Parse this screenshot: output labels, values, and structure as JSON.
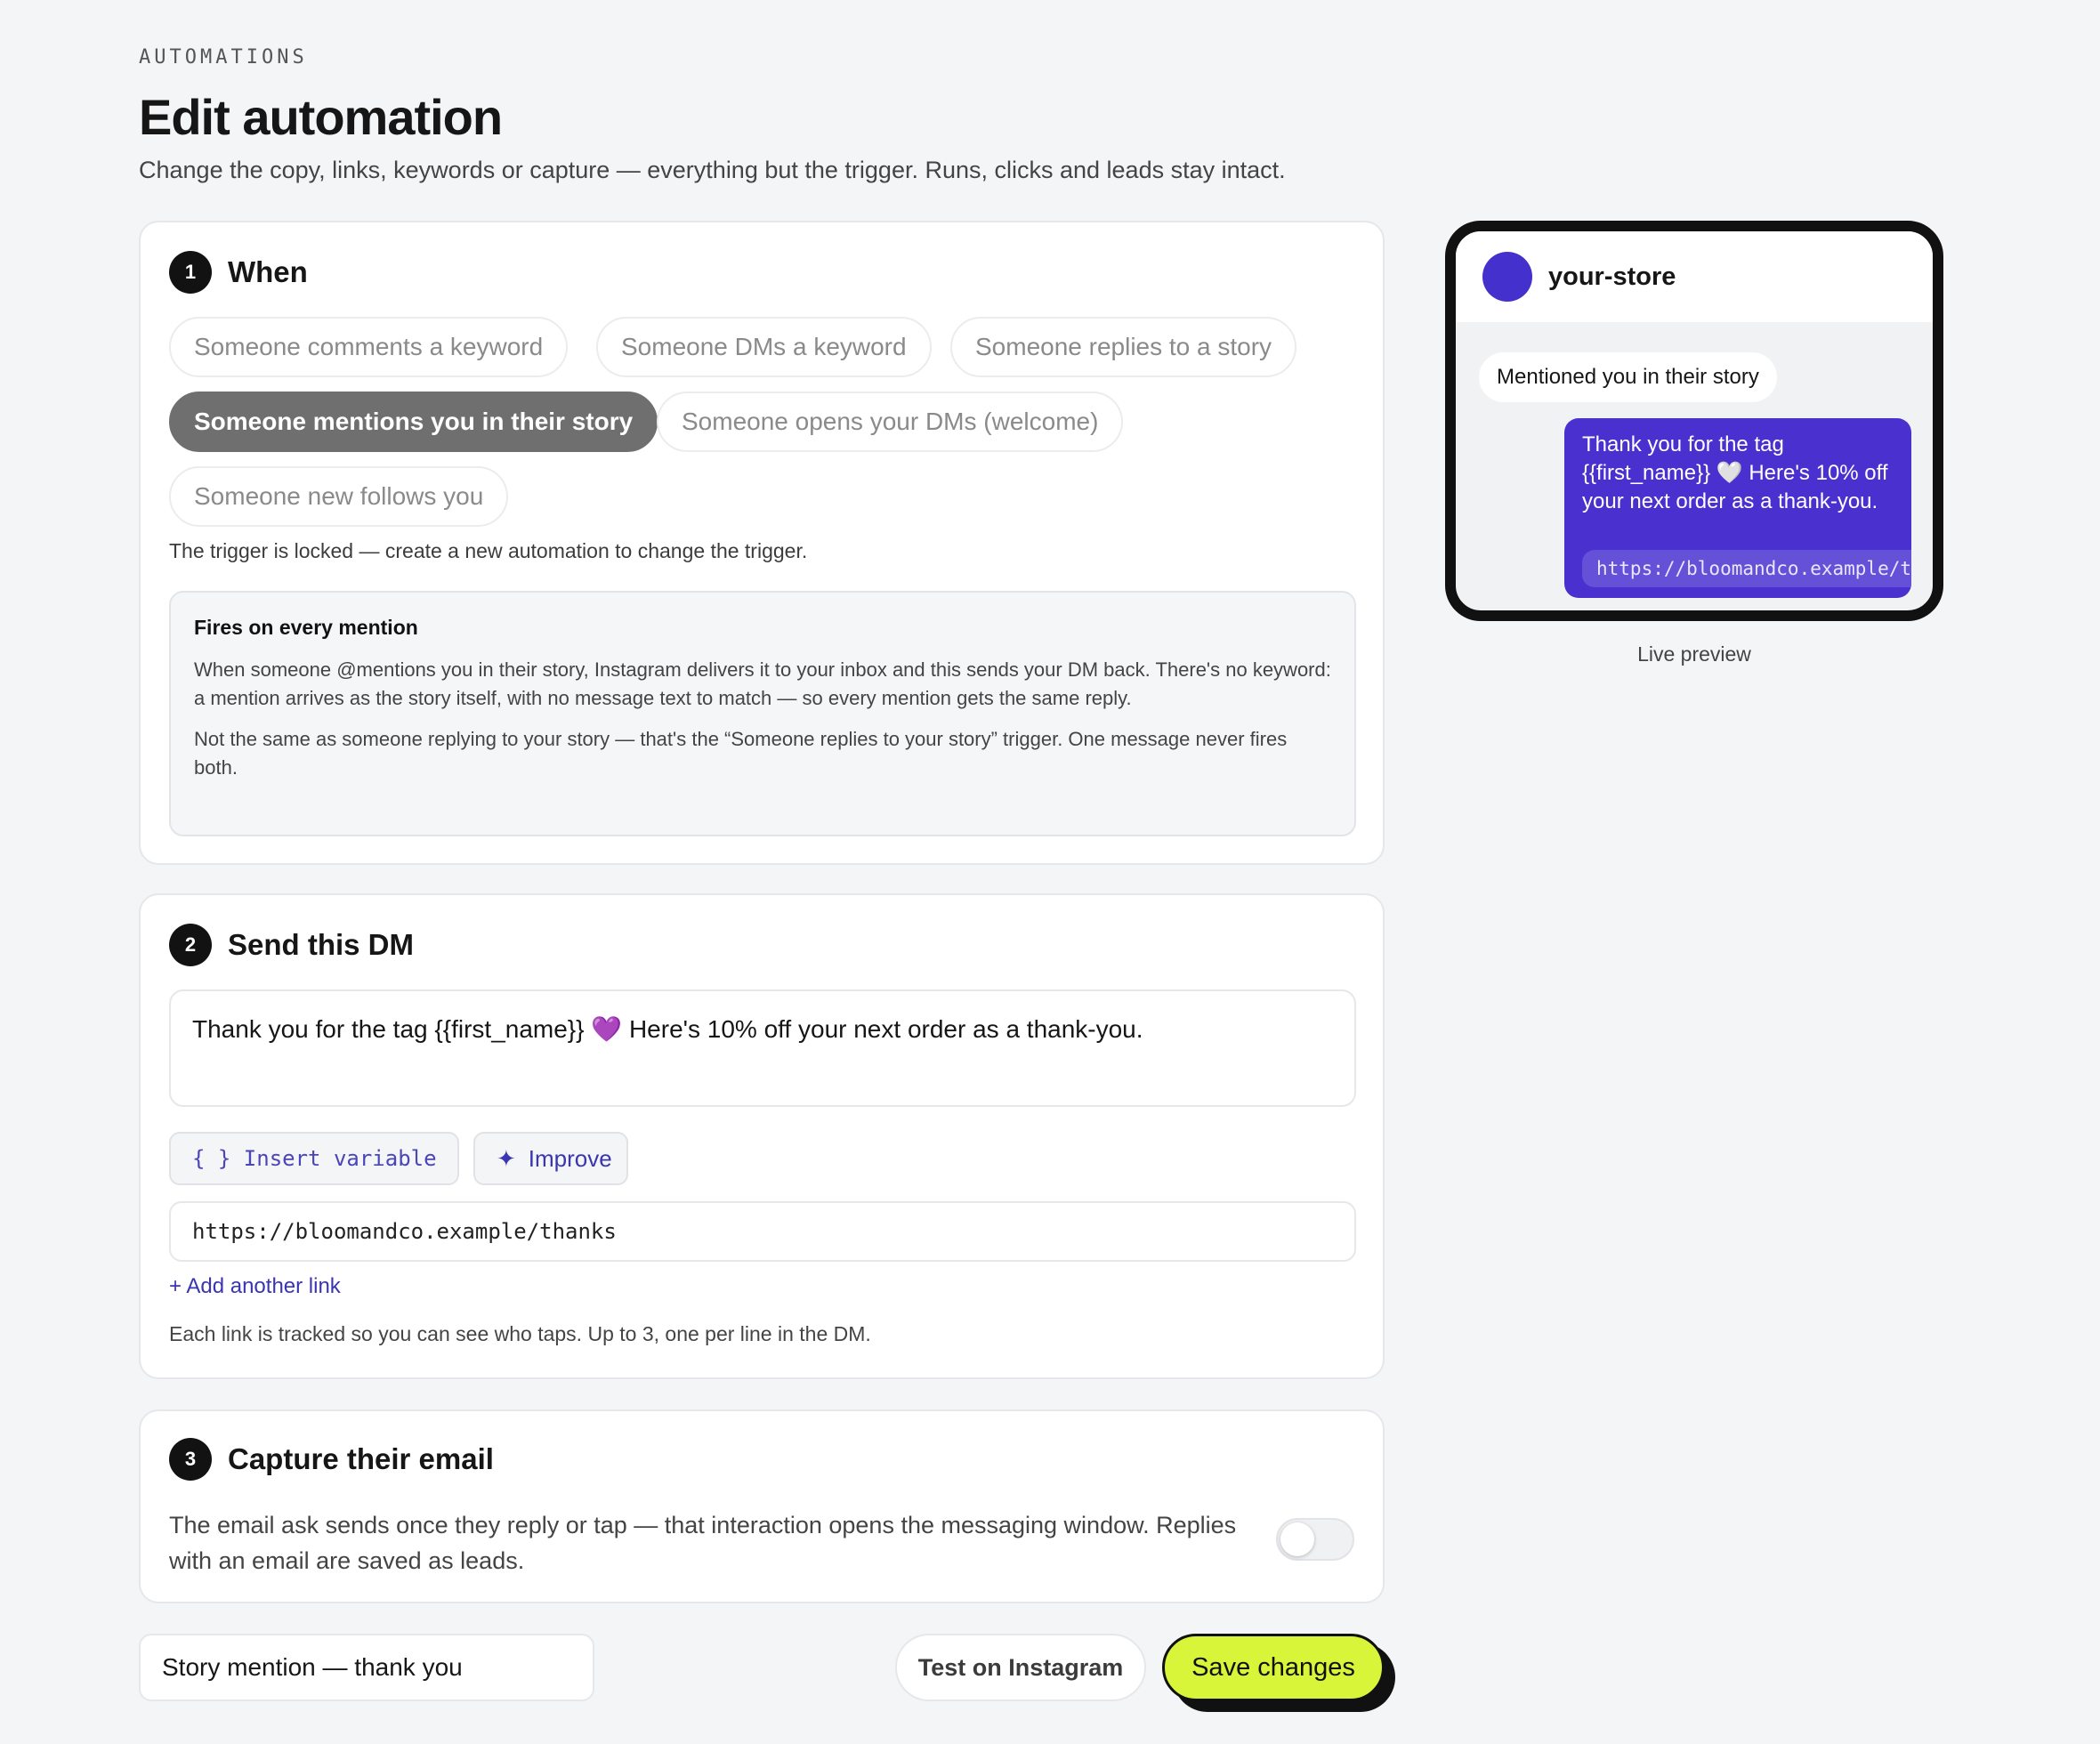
{
  "header": {
    "eyebrow": "AUTOMATIONS",
    "title": "Edit automation",
    "subtitle": "Change the copy, links, keywords or capture — everything but the trigger. Runs, clicks and leads stay intact."
  },
  "when": {
    "step": "1",
    "title": "When",
    "triggers": [
      {
        "label": "Someone comments a keyword",
        "selected": false
      },
      {
        "label": "Someone DMs a keyword",
        "selected": false
      },
      {
        "label": "Someone replies to a story",
        "selected": false
      },
      {
        "label": "Someone mentions you in their story",
        "selected": true
      },
      {
        "label": "Someone opens your DMs (welcome)",
        "selected": false
      },
      {
        "label": "Someone new follows you",
        "selected": false
      }
    ],
    "lock_note": "The trigger is locked — create a new automation to change the trigger.",
    "info": {
      "title": "Fires on every mention",
      "p1": "When someone @mentions you in their story, Instagram delivers it to your inbox and this sends your DM back. There's no keyword: a mention arrives as the story itself, with no message text to match — so every mention gets the same reply.",
      "p2": "Not the same as someone replying to your story — that's the “Someone replies to your story” trigger. One message never fires both."
    }
  },
  "send_dm": {
    "step": "2",
    "title": "Send this DM",
    "message_before": "Thank you for the tag {{first_name}}",
    "message_emoji": "💜",
    "message_after": " Here's 10% off your next order as a thank-you.",
    "insert_variable_label": "{ } Insert variable",
    "improve_icon": "✦",
    "improve_label": "Improve",
    "link_value": "https://bloomandco.example/thanks",
    "add_link_label": "+ Add another link",
    "link_note": "Each link is tracked so you can see who taps. Up to 3, one per line in the DM."
  },
  "capture": {
    "step": "3",
    "title": "Capture their email",
    "description": "The email ask sends once they reply or tap — that interaction opens the messaging window. Replies with an email are saved as leads.",
    "enabled": false
  },
  "footer": {
    "automation_name": "Story mention — thank you",
    "test_label": "Test on Instagram",
    "save_label": "Save changes"
  },
  "preview": {
    "store_name": "your-store",
    "incoming": "Mentioned you in their story",
    "outgoing": "Thank you for the tag {{first_name}} 🤍 Here's 10% off your next order as a thank-you.",
    "outgoing_link": "https://bloomandco.example/thanks",
    "label": "Live preview",
    "avatar_color": "#4430cc"
  },
  "colors": {
    "accent": "#3a35b0",
    "save_button": "#d9f53a",
    "bubble": "#4a30cf"
  }
}
